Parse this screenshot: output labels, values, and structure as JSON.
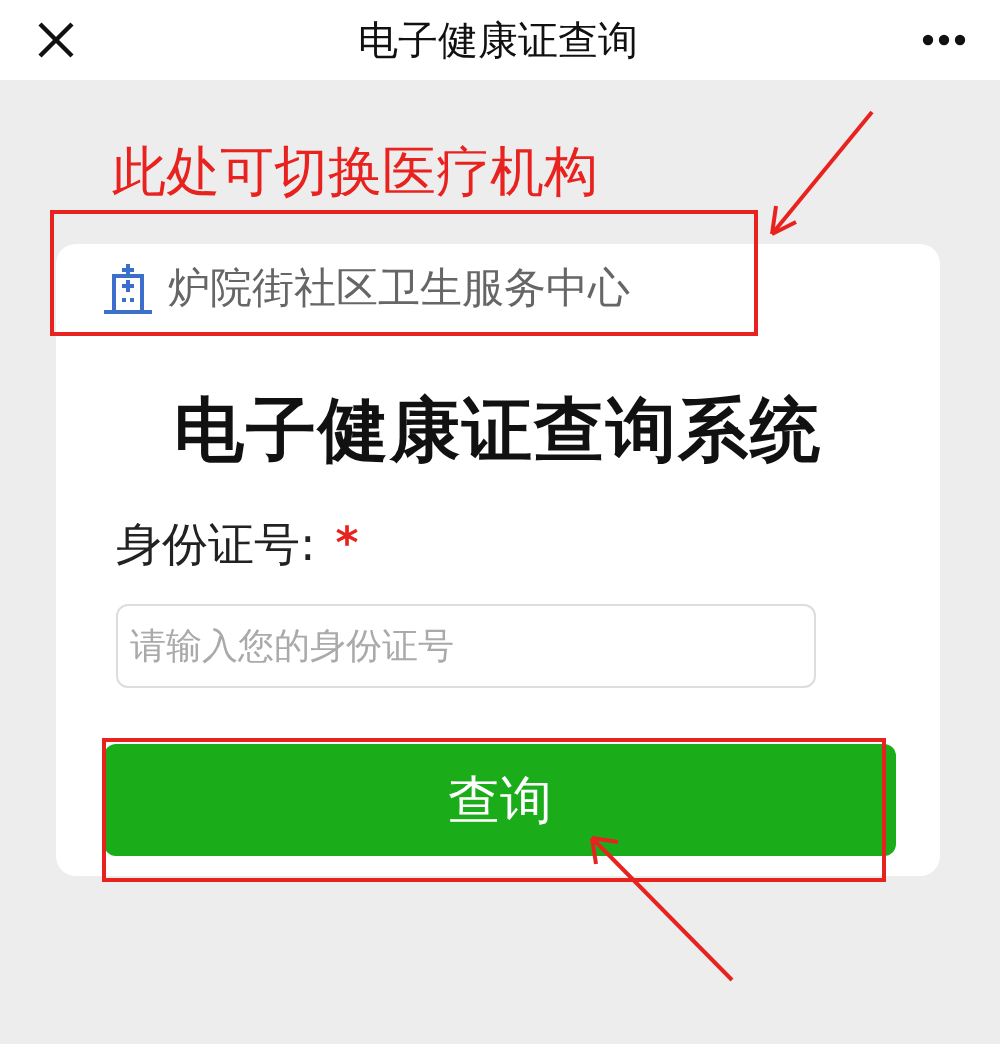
{
  "top_bar": {
    "title": "电子健康证查询"
  },
  "annotation": {
    "text": "此处可切换医疗机构"
  },
  "institution": {
    "name": "炉院街社区卫生服务中心"
  },
  "form": {
    "title": "电子健康证查询系统",
    "id_label": "身份证号:",
    "required_mark": "*",
    "id_field": {
      "placeholder": "请输入您的身份证号"
    },
    "submit": "查询"
  }
}
